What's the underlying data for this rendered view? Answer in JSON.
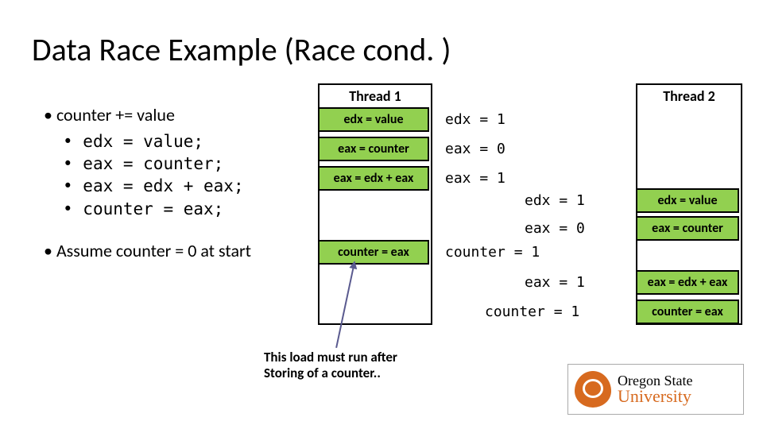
{
  "title": "Data Race Example (Race cond. )",
  "left": {
    "expr": "counter += value",
    "code": [
      "edx = value;",
      "eax = counter;",
      "eax = edx + eax;",
      "counter = eax;"
    ],
    "assume": "Assume counter = 0 at start"
  },
  "threads": {
    "t1_header": "Thread 1",
    "t2_header": "Thread 2",
    "t1": {
      "a": "edx = value",
      "b": "eax = counter",
      "c": "eax = edx + eax",
      "d": "counter = eax"
    },
    "t2": {
      "a": "edx = value",
      "b": "eax = counter",
      "c": "eax = edx + eax",
      "d": "counter = eax"
    }
  },
  "annotations": {
    "a1": "edx = 1",
    "a2": "eax = 0",
    "a3": "eax = 1",
    "a4": "edx = 1",
    "a5": "eax = 0",
    "a6": "counter = 1",
    "a7": "eax = 1",
    "a8": "counter = 1"
  },
  "callout": {
    "l1": "This load must run after",
    "l2": "Storing of a counter.."
  },
  "logo": {
    "line1": "Oregon State",
    "line2": "University"
  }
}
